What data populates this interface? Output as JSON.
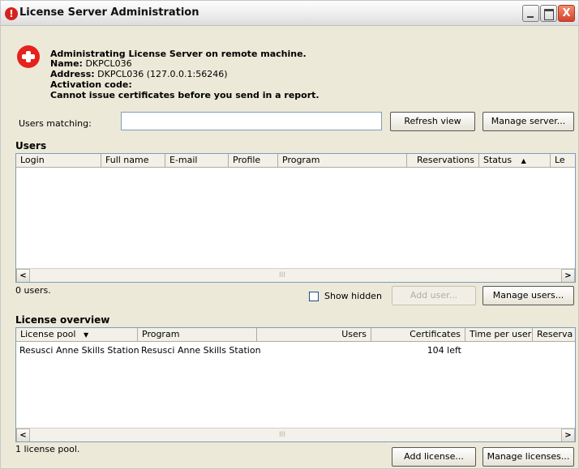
{
  "window": {
    "title": "License Server Administration",
    "app_icon_glyph": "!",
    "close_glyph": "X"
  },
  "info": {
    "line1": "Administrating License Server on remote machine.",
    "name_label": "Name:",
    "name_value": "DKPCL036",
    "address_label": "Address:",
    "address_value": "DKPCL036 (127.0.0.1:56246)",
    "activation_label": "Activation code:",
    "warning": "Cannot issue certificates before you send in a report."
  },
  "filter": {
    "label": "Users matching:",
    "value": "",
    "refresh_label": "Refresh view",
    "manage_server_label": "Manage server..."
  },
  "users": {
    "title": "Users",
    "columns": [
      "Login",
      "Full name",
      "E-mail",
      "Profile",
      "Program",
      "Reservations",
      "Status",
      "Le"
    ],
    "sort_arrow": "▲",
    "count_text": "0 users.",
    "show_hidden_label": "Show hidden",
    "add_user_label": "Add user...",
    "manage_users_label": "Manage users..."
  },
  "licenses": {
    "title": "License overview",
    "columns": [
      "License pool",
      "Program",
      "Users",
      "Certificates",
      "Time per user",
      "Reserva"
    ],
    "sort_arrow": "▼",
    "rows": [
      {
        "pool": "Resusci Anne Skills Station",
        "program": "Resusci Anne Skills Station",
        "users": "",
        "certificates": "104 left",
        "time_per_user": ""
      }
    ],
    "count_text": "1 license pool.",
    "add_license_label": "Add license...",
    "manage_licenses_label": "Manage licenses..."
  },
  "scroll": {
    "left_arrow": "<",
    "right_arrow": ">",
    "grip": "III"
  },
  "colors": {
    "accent_red": "#e5221c",
    "window_bg": "#ece9d8"
  }
}
